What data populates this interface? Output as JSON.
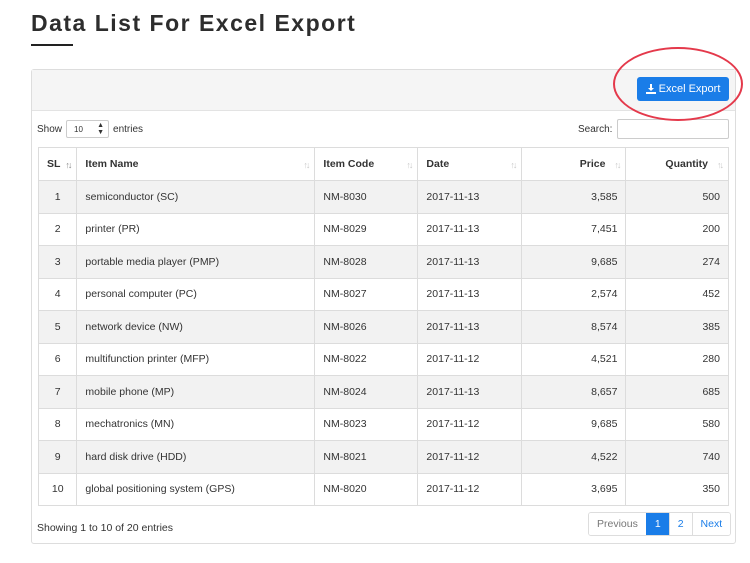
{
  "page": {
    "title": "Data List For Excel Export"
  },
  "toolbar": {
    "export_label": "Excel Export"
  },
  "controls": {
    "show_label": "Show",
    "entries_label": "entries",
    "page_length_value": "10",
    "search_label": "Search:",
    "search_value": ""
  },
  "table": {
    "columns": [
      "SL",
      "Item Name",
      "Item Code",
      "Date",
      "Price",
      "Quantity"
    ],
    "rows": [
      {
        "sl": "1",
        "name": "semiconductor (SC)",
        "code": "NM-8030",
        "date": "2017-11-13",
        "price": "3,585",
        "qty": "500"
      },
      {
        "sl": "2",
        "name": "printer (PR)",
        "code": "NM-8029",
        "date": "2017-11-13",
        "price": "7,451",
        "qty": "200"
      },
      {
        "sl": "3",
        "name": "portable media player (PMP)",
        "code": "NM-8028",
        "date": "2017-11-13",
        "price": "9,685",
        "qty": "274"
      },
      {
        "sl": "4",
        "name": "personal computer (PC)",
        "code": "NM-8027",
        "date": "2017-11-13",
        "price": "2,574",
        "qty": "452"
      },
      {
        "sl": "5",
        "name": "network device (NW)",
        "code": "NM-8026",
        "date": "2017-11-13",
        "price": "8,574",
        "qty": "385"
      },
      {
        "sl": "6",
        "name": "multifunction printer (MFP)",
        "code": "NM-8022",
        "date": "2017-11-12",
        "price": "4,521",
        "qty": "280"
      },
      {
        "sl": "7",
        "name": "mobile phone (MP)",
        "code": "NM-8024",
        "date": "2017-11-13",
        "price": "8,657",
        "qty": "685"
      },
      {
        "sl": "8",
        "name": "mechatronics (MN)",
        "code": "NM-8023",
        "date": "2017-11-12",
        "price": "9,685",
        "qty": "580"
      },
      {
        "sl": "9",
        "name": "hard disk drive (HDD)",
        "code": "NM-8021",
        "date": "2017-11-12",
        "price": "4,522",
        "qty": "740"
      },
      {
        "sl": "10",
        "name": "global positioning system (GPS)",
        "code": "NM-8020",
        "date": "2017-11-12",
        "price": "3,695",
        "qty": "350"
      }
    ]
  },
  "footer": {
    "info": "Showing 1 to 10 of 20 entries",
    "pagination": {
      "previous": "Previous",
      "pages": [
        "1",
        "2"
      ],
      "next": "Next"
    }
  },
  "colors": {
    "accent": "#1a7de8",
    "highlight_ring": "#e4394b",
    "stripe": "#f2f2f2"
  },
  "icons": {
    "export": "download-icon",
    "sort": "sort-arrows-icon"
  }
}
